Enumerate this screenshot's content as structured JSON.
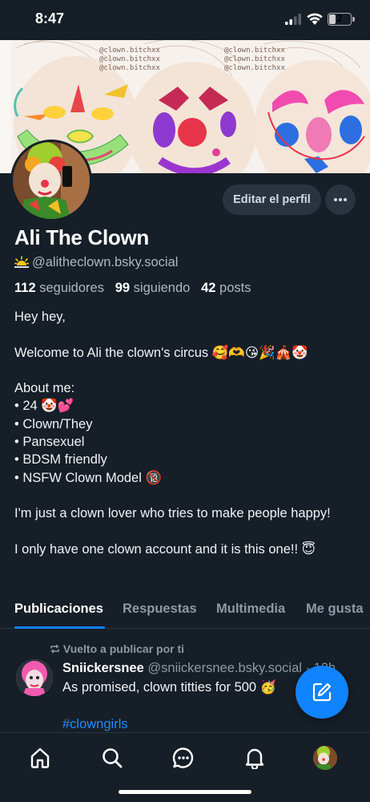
{
  "status_bar": {
    "time": "8:47",
    "battery": "2"
  },
  "banner": {
    "watermarks": [
      "@clown.bitchxx",
      "@clown.bitchxx",
      "@clown.bitchxx",
      "@clown.bitchxx",
      "@clown.bitchxx",
      "@clown.bitchxx"
    ]
  },
  "profile": {
    "edit_label": "Editar el perfil",
    "display_name": "Ali The Clown",
    "handle": "@alitheclown.bsky.social",
    "followers_count": "112",
    "followers_label": "seguidores",
    "following_count": "99",
    "following_label": "siguiendo",
    "posts_count": "42",
    "posts_label": "posts",
    "bio": "Hey hey,\n\nWelcome to Ali the clown's circus 🥰🫶😘🎉🎪🤡\n\nAbout me:\n• 24 🤡💕\n• Clown/They\n• Pansexuel\n• BDSM friendly\n• NSFW Clown Model 🔞\n\nI'm just a clown lover who tries to make people happy!\n\nI only have one clown account and it is this one!! 😇"
  },
  "tabs": [
    "Publicaciones",
    "Respuestas",
    "Multimedia",
    "Me gusta"
  ],
  "feed": {
    "repost_label": "Vuelto a publicar por ti",
    "post": {
      "author": "Sniickersnee",
      "handle": "@sniickersnee.bsky.social",
      "time": "12h",
      "text": "As promised, clown titties for 500 🥳",
      "tag": "#clowngirls"
    }
  },
  "colors": {
    "background": "#161e27",
    "accent": "#1083fe",
    "link": "#208bfe",
    "muted": "#8e99a4"
  },
  "icons": {
    "nav": [
      "home-icon",
      "search-icon",
      "chat-icon",
      "bell-icon",
      "profile-avatar"
    ],
    "fab": "compose-icon",
    "more": "more-dots-icon",
    "repost": "repost-icon"
  }
}
